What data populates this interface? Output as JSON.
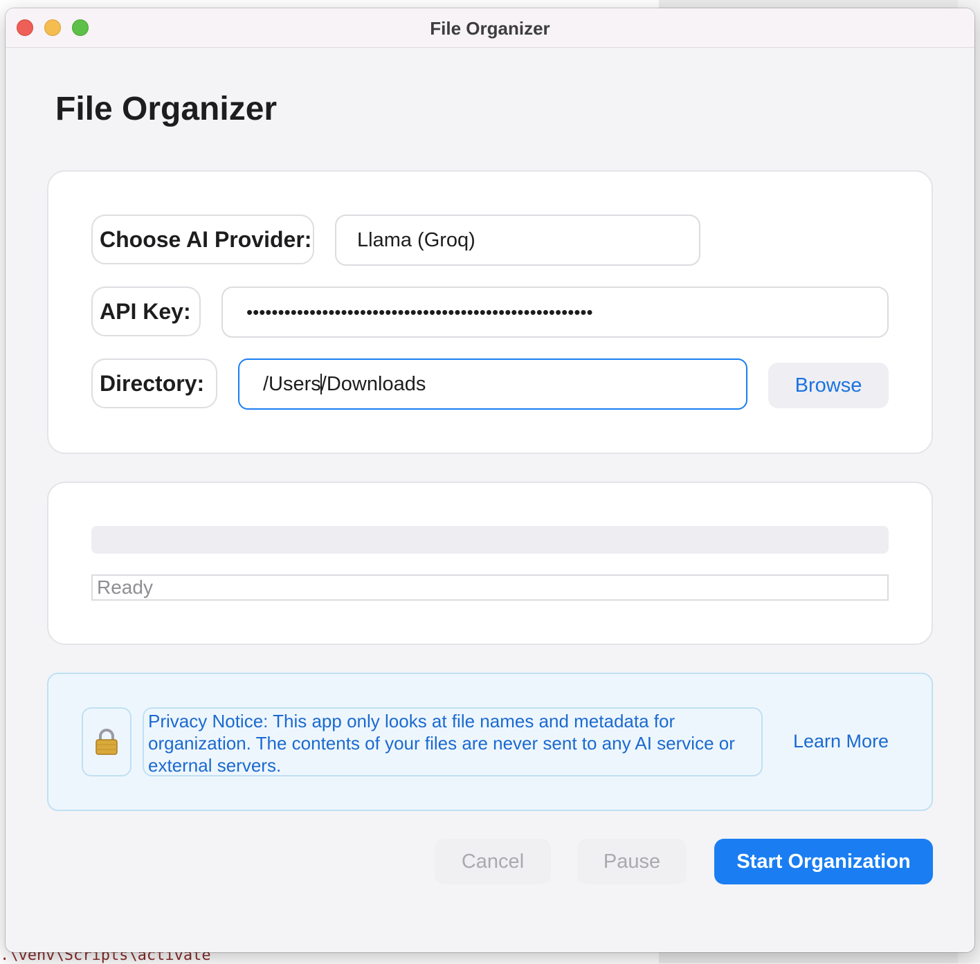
{
  "window": {
    "title": "File Organizer"
  },
  "page": {
    "title": "File Organizer"
  },
  "form": {
    "provider_label": "Choose AI Provider:",
    "provider_value": "Llama (Groq)",
    "api_key_label": "API Key:",
    "api_key_value": "•••••••••••••••••••••••••••••••••••••••••••••••••••••••",
    "directory_label": "Directory:",
    "directory_value_before_caret": "/Users",
    "directory_value_after_caret": "/Downloads",
    "browse_label": "Browse"
  },
  "progress": {
    "value": 0,
    "status_text": "Ready"
  },
  "privacy": {
    "icon": "lock-icon",
    "notice": "Privacy Notice: This app only looks at file names and metadata for organization. The contents of your files are never sent to any AI service or external servers.",
    "learn_more": "Learn More"
  },
  "actions": {
    "cancel": "Cancel",
    "pause": "Pause",
    "start": "Start Organization"
  },
  "background": {
    "terminal_text": ".\\venv\\Scripts\\activate"
  },
  "colors": {
    "accent": "#1a7ef2",
    "link": "#1a73e0",
    "notice_bg": "#eef6fd"
  }
}
